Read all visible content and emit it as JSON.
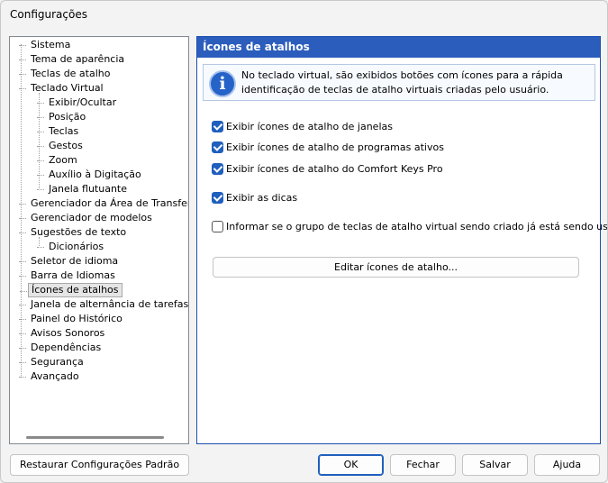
{
  "window": {
    "title": "Configurações"
  },
  "tree": {
    "items": [
      {
        "label": "Sistema",
        "level": 0
      },
      {
        "label": "Tema de aparência",
        "level": 0
      },
      {
        "label": "Teclas de atalho",
        "level": 0
      },
      {
        "label": "Teclado Virtual",
        "level": 0
      },
      {
        "label": "Exibir/Ocultar",
        "level": 1
      },
      {
        "label": "Posição",
        "level": 1
      },
      {
        "label": "Teclas",
        "level": 1
      },
      {
        "label": "Gestos",
        "level": 1
      },
      {
        "label": "Zoom",
        "level": 1
      },
      {
        "label": "Auxílio à Digitação",
        "level": 1
      },
      {
        "label": "Janela flutuante",
        "level": 1
      },
      {
        "label": "Gerenciador da Área de Transferênc",
        "level": 0
      },
      {
        "label": "Gerenciador de modelos",
        "level": 0
      },
      {
        "label": "Sugestões de texto",
        "level": 0
      },
      {
        "label": "Dicionários",
        "level": 1
      },
      {
        "label": "Seletor de idioma",
        "level": 0
      },
      {
        "label": "Barra de Idiomas",
        "level": 0
      },
      {
        "label": "Ícones de atalhos",
        "level": 0,
        "selected": true
      },
      {
        "label": "Janela de alternância de tarefas",
        "level": 0
      },
      {
        "label": "Painel do Histórico",
        "level": 0
      },
      {
        "label": "Avisos Sonoros",
        "level": 0
      },
      {
        "label": "Dependências",
        "level": 0
      },
      {
        "label": "Segurança",
        "level": 0
      },
      {
        "label": "Avançado",
        "level": 0
      }
    ]
  },
  "panel": {
    "title": "Ícones de atalhos",
    "info_icon": "info-icon",
    "info_text": "No teclado virtual, são exibidos botões com ícones para a rápida identificação de teclas de atalho virtuais criadas pelo usuário.",
    "options": {
      "window_icons": {
        "label": "Exibir ícones de atalho de janelas",
        "checked": true
      },
      "active_program_icons": {
        "label": "Exibir ícones de atalho de programas ativos",
        "checked": true
      },
      "comfort_keys_icons": {
        "label": "Exibir ícones de atalho do Comfort Keys Pro",
        "checked": true
      },
      "show_tips": {
        "label": "Exibir as dicas",
        "checked": true
      },
      "warn_group_in_use": {
        "label": "Informar se o grupo de teclas de atalho virtual sendo criado já está sendo usado",
        "checked": false
      }
    },
    "edit_button": "Editar ícones de atalho..."
  },
  "footer": {
    "restore": "Restaurar Configurações Padrão",
    "ok": "OK",
    "close": "Fechar",
    "save": "Salvar",
    "help": "Ajuda"
  },
  "colors": {
    "accent": "#2b5dbd",
    "checkbox": "#1f5fbd"
  }
}
